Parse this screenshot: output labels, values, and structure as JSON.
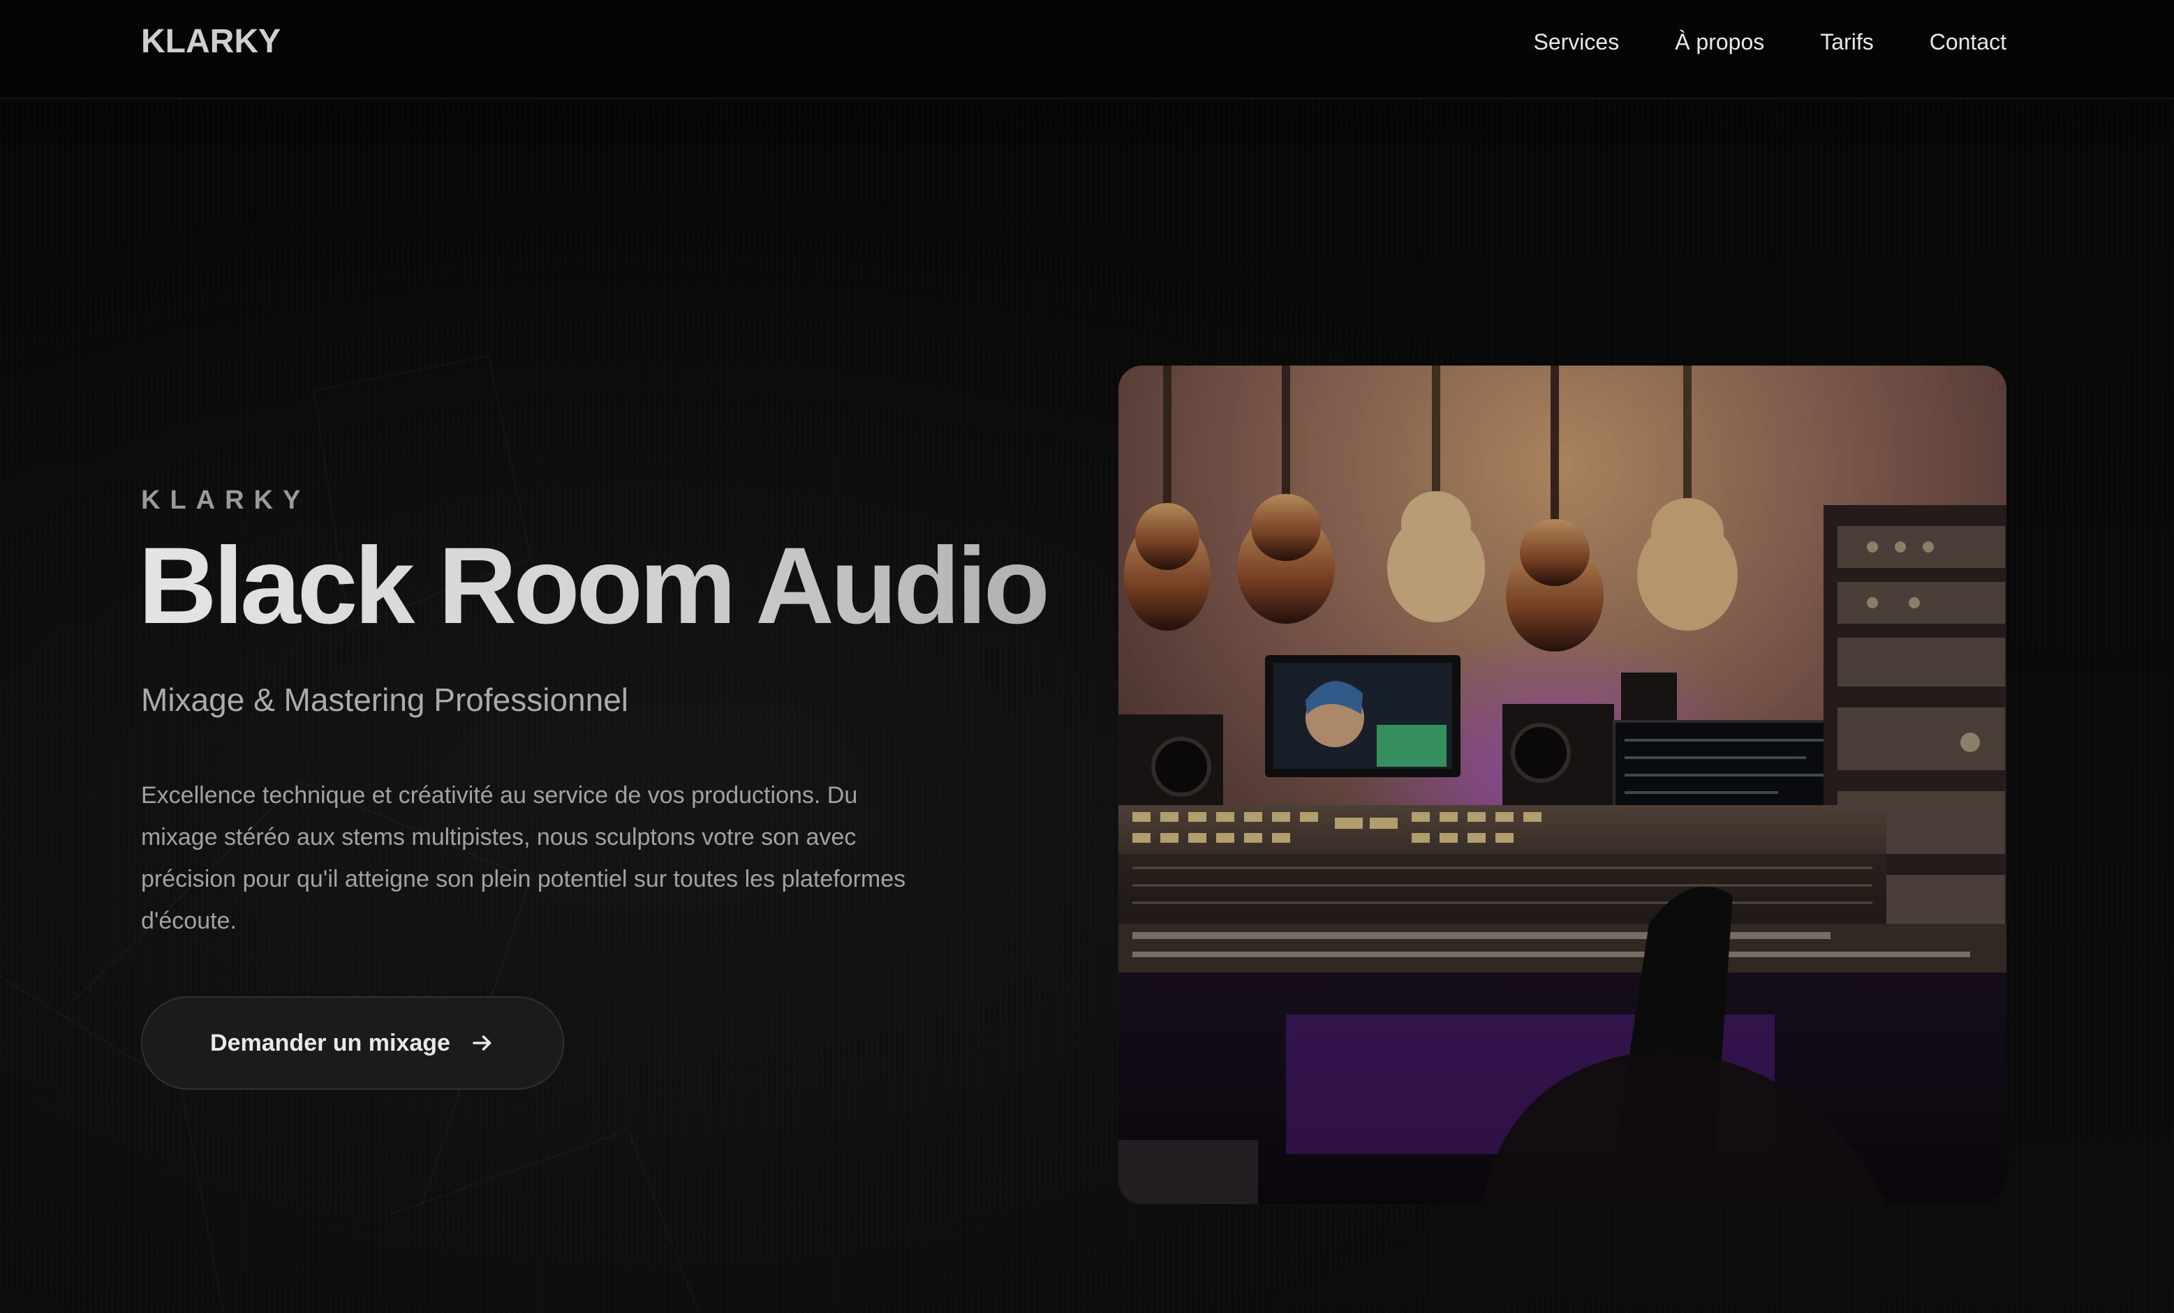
{
  "header": {
    "logo": "KLARKY",
    "nav": [
      {
        "label": "Services"
      },
      {
        "label": "À propos"
      },
      {
        "label": "Tarifs"
      },
      {
        "label": "Contact"
      }
    ]
  },
  "hero": {
    "eyebrow": "KLARKY",
    "title": "Black Room Audio",
    "subtitle": "Mixage & Mastering Professionnel",
    "description": "Excellence technique et créativité au service de vos productions. Du mixage stéréo aux stems multipistes, nous sculptons votre son avec précision pour qu'il atteigne son plein potentiel sur toutes les plateformes d'écoute.",
    "cta_label": "Demander un mixage",
    "cta_icon": "arrow-right-icon"
  },
  "image": {
    "subject": "recording-studio-photo"
  },
  "colors": {
    "background": "#050505",
    "button": "#1b1b1b",
    "accent_purple": "#7a2fb0"
  }
}
